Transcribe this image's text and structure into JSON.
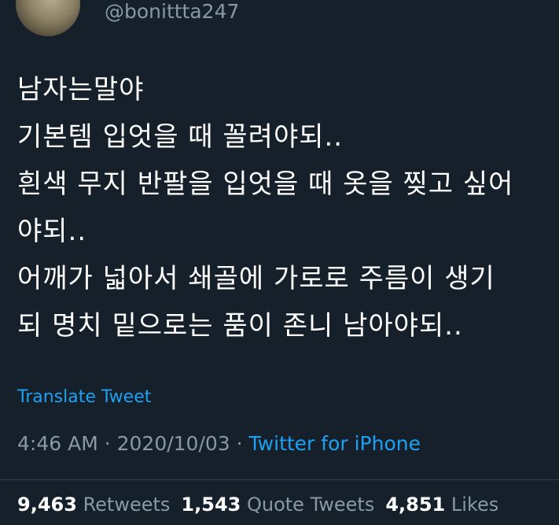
{
  "author": {
    "handle": "@bonittta247",
    "avatar_icon": "profile-photo"
  },
  "tweet": {
    "lines": [
      "남자는말야",
      "기본템 입엇을 때 꼴려야되..",
      "흰색 무지 반팔을 입엇을 때 옷을 찢고 싶어",
      "야되..",
      "어깨가 넓아서 쇄골에 가로로 주름이 생기",
      "되 명치 밑으로는 품이 존니 남아야되.."
    ],
    "translate_label": "Translate Tweet"
  },
  "meta": {
    "time": "4:46 AM",
    "separator": " · ",
    "date": "2020/10/03",
    "source": "Twitter for iPhone"
  },
  "stats": {
    "retweets": {
      "count": "9,463",
      "label": "Retweets"
    },
    "quote_tweets": {
      "count": "1,543",
      "label": "Quote Tweets"
    },
    "likes": {
      "count": "4,851",
      "label": "Likes"
    }
  },
  "colors": {
    "background": "#15202b",
    "text": "#ffffff",
    "secondary": "#8899a6",
    "accent": "#1da1f2",
    "divider": "#38444d"
  }
}
